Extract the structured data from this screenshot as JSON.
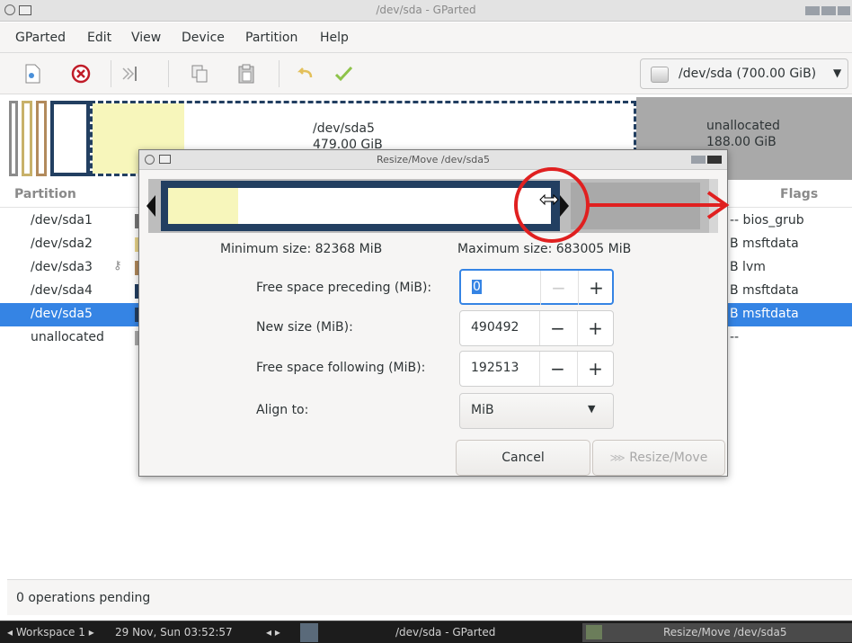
{
  "window": {
    "title": "/dev/sda - GParted"
  },
  "menu": {
    "items": [
      "GParted",
      "Edit",
      "View",
      "Device",
      "Partition",
      "Help"
    ]
  },
  "toolbar": {
    "device_label": "/dev/sda (700.00 GiB)",
    "device_arrow": "▼"
  },
  "graph": {
    "sda5_name": "/dev/sda5",
    "sda5_size": "479.00 GiB",
    "unalloc_name": "unallocated",
    "unalloc_size": "188.00 GiB"
  },
  "list": {
    "headers": {
      "partition": "Partition",
      "flags": "Flags"
    },
    "rows": [
      {
        "name": "/dev/sda1",
        "flags": "-- bios_grub"
      },
      {
        "name": "/dev/sda2",
        "flags": "B  msftdata"
      },
      {
        "name": "/dev/sda3",
        "flags": "B  lvm"
      },
      {
        "name": "/dev/sda4",
        "flags": "B  msftdata"
      },
      {
        "name": "/dev/sda5",
        "flags": "B  msftdata"
      },
      {
        "name": "unallocated",
        "flags": "--"
      }
    ]
  },
  "status": {
    "pending": "0 operations pending"
  },
  "dialog": {
    "title": "Resize/Move /dev/sda5",
    "min_size": "Minimum size: 82368 MiB",
    "max_size": "Maximum size: 683005 MiB",
    "preceding_label": "Free space preceding (MiB):",
    "preceding_value": "0",
    "new_size_label": "New size (MiB):",
    "new_size_value": "490492",
    "following_label": "Free space following (MiB):",
    "following_value": "192513",
    "align_label": "Align to:",
    "align_value": "MiB",
    "cancel": "Cancel",
    "resize_move": "Resize/Move",
    "minus": "−",
    "plus": "+"
  },
  "taskbar": {
    "workspace": "◂ Workspace 1 ▸",
    "datetime": "29 Nov, Sun 03:52:57",
    "nav": "◂ ▸",
    "task1": "/dev/sda - GParted",
    "task2": "Resize/Move /dev/sda5"
  },
  "colors": {
    "selection": "#3584e4",
    "partition_border": "#223f61",
    "used": "#f7f6bb",
    "unallocated": "#a9a9a9",
    "annotation": "#e02020"
  }
}
